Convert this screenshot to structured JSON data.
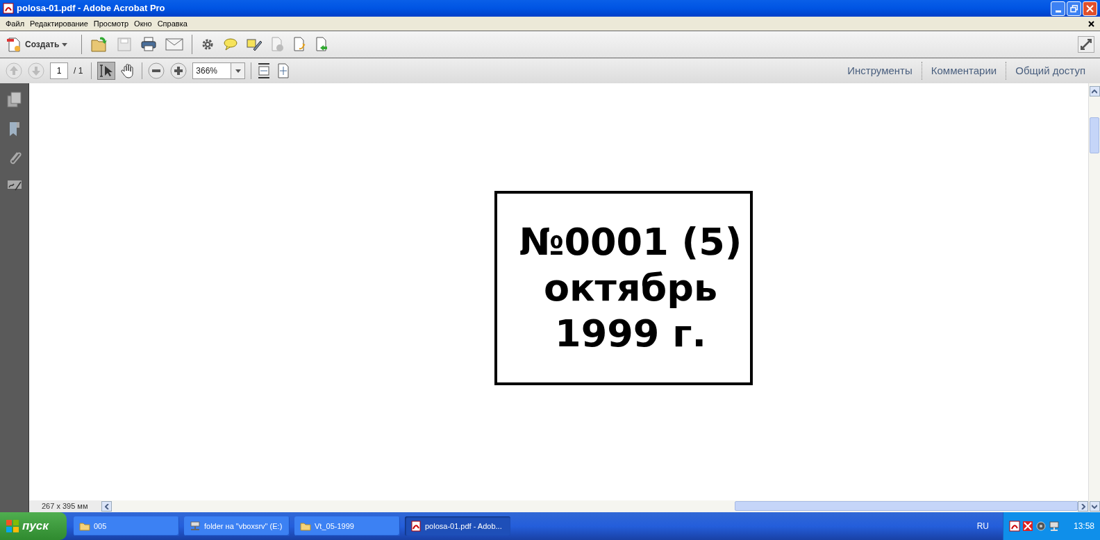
{
  "window": {
    "title": "polosa-01.pdf - Adobe Acrobat Pro"
  },
  "menu": [
    "Файл",
    "Редактирование",
    "Просмотр",
    "Окно",
    "Справка"
  ],
  "toolbar": {
    "create_label": "Создать"
  },
  "navigation": {
    "page_number": "1",
    "page_total": "/ 1",
    "zoom": "366%",
    "select_tool_selected": true
  },
  "panes": [
    "Инструменты",
    "Комментарии",
    "Общий доступ"
  ],
  "document": {
    "lines": [
      "№0001 (5)",
      "октябрь",
      "1999 г."
    ]
  },
  "status_bar": {
    "page_size": "267 x 395 мм"
  },
  "taskbar": {
    "start": "пуск",
    "tasks": [
      {
        "kind": "folder",
        "label": "005",
        "selected": false
      },
      {
        "kind": "network",
        "label": "folder на \"vboxsrv\" (E:)",
        "selected": false
      },
      {
        "kind": "folder",
        "label": "Vt_05-1999",
        "selected": false
      },
      {
        "kind": "pdf",
        "label": "polosa-01.pdf - Adob...",
        "selected": true
      }
    ],
    "language": "RU",
    "clock": "13:58"
  }
}
